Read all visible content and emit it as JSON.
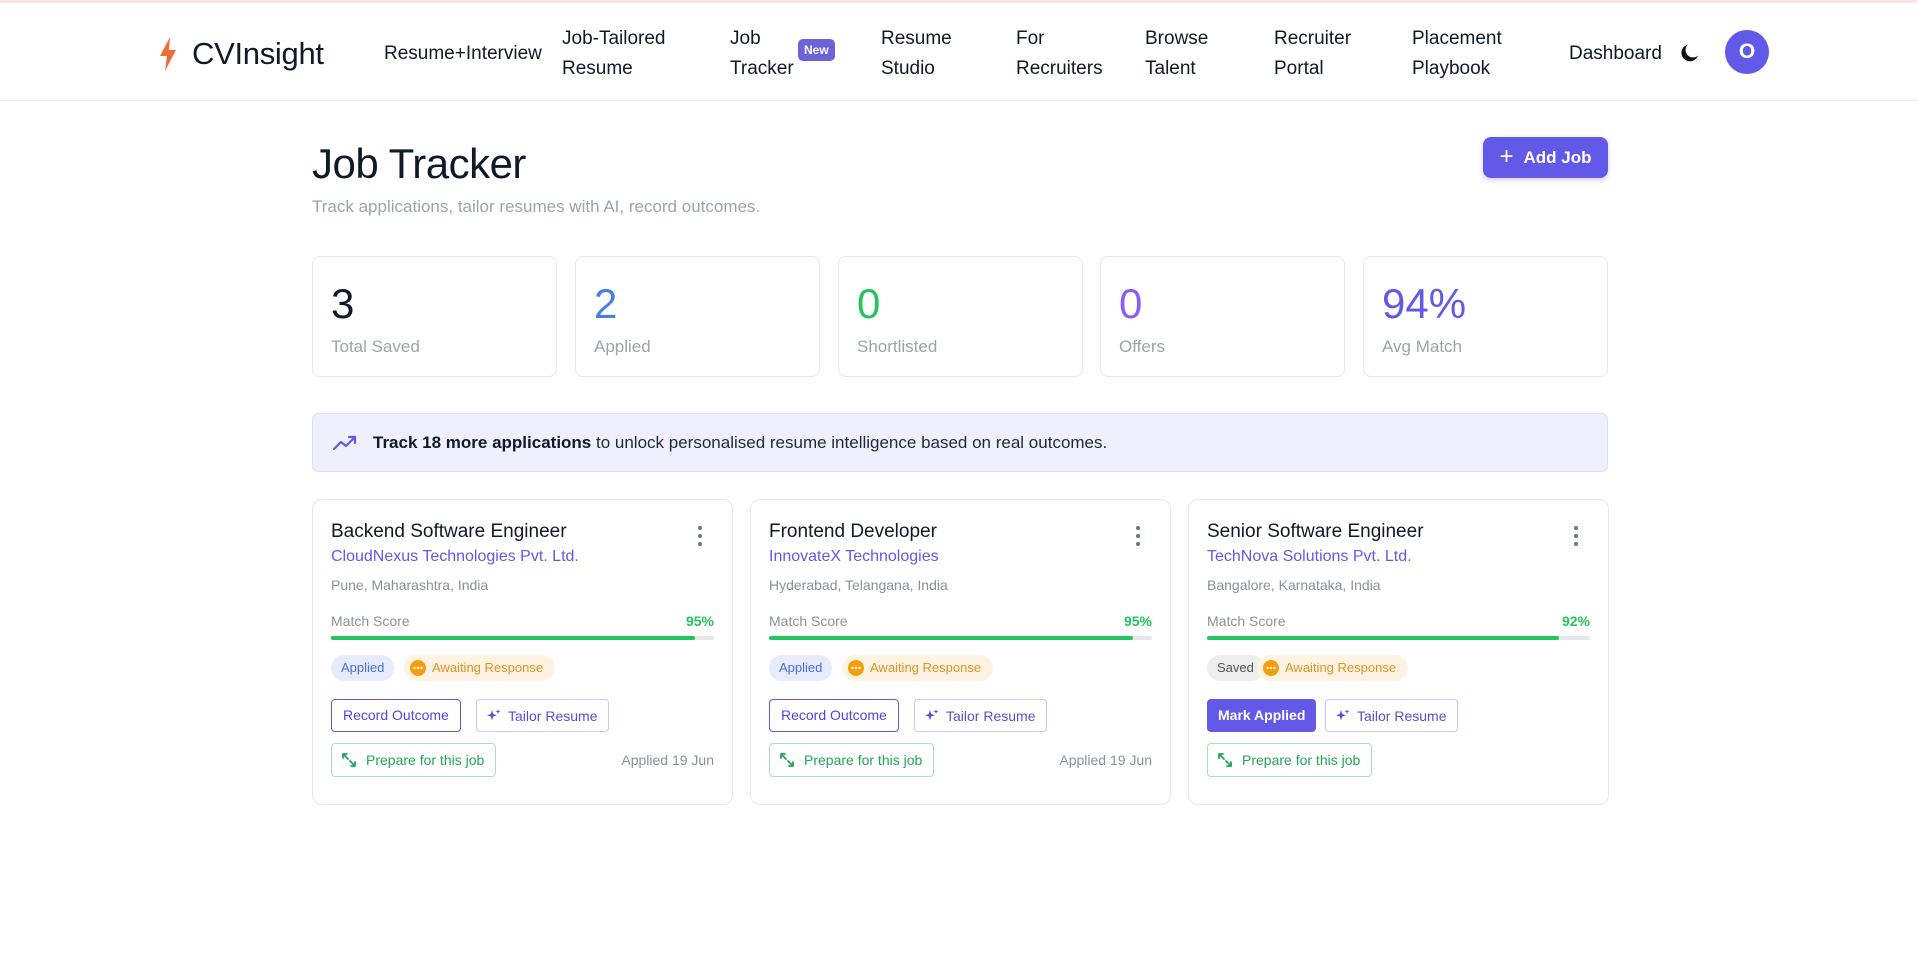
{
  "app": {
    "brand": "CVInsight",
    "accent": "#6259e8",
    "brand_icon": "lightning-bolt-icon"
  },
  "nav": {
    "items": [
      {
        "label_1": "Resume+Interview",
        "label_2": ""
      },
      {
        "label_1": "Job-Tailored",
        "label_2": "Resume"
      },
      {
        "label_1": "Job",
        "label_2": "Tracker",
        "badge": "New"
      },
      {
        "label_1": "Resume",
        "label_2": "Studio"
      },
      {
        "label_1": "For",
        "label_2": "Recruiters"
      },
      {
        "label_1": "Browse",
        "label_2": "Talent"
      },
      {
        "label_1": "Recruiter",
        "label_2": "Portal"
      },
      {
        "label_1": "Placement",
        "label_2": "Playbook"
      }
    ],
    "dashboard": "Dashboard",
    "theme_icon": "moon-icon",
    "avatar_initial": "O"
  },
  "page": {
    "title": "Job Tracker",
    "subtitle": "Track applications, tailor resumes with AI, record outcomes.",
    "add_job_label": "Add Job"
  },
  "stats": [
    {
      "value": "3",
      "label": "Total Saved",
      "color": "#111827"
    },
    {
      "value": "2",
      "label": "Applied",
      "color": "#4a7fe0"
    },
    {
      "value": "0",
      "label": "Shortlisted",
      "color": "#22c55e"
    },
    {
      "value": "0",
      "label": "Offers",
      "color": "#8b5cf6"
    },
    {
      "value": "94%",
      "label": "Avg Match",
      "color": "#6259e8"
    }
  ],
  "banner": {
    "bold": "Track 18 more applications",
    "rest": " to unlock personalised resume intelligence based on real outcomes."
  },
  "jobs": [
    {
      "title": "Backend Software Engineer",
      "company": "CloudNexus Technologies Pvt. Ltd.",
      "location": "Pune, Maharashtra, India",
      "match_label": "Match Score",
      "match_text": "95%",
      "match": 0.95,
      "status": "Applied",
      "await": "Awaiting Response",
      "action": "Record Outcome",
      "tailor": "Tailor Resume",
      "prepare": "Prepare for this job",
      "date": "Applied 19 Jun"
    },
    {
      "title": "Frontend Developer",
      "company": "InnovateX Technologies",
      "location": "Hyderabad, Telangana, India",
      "match_label": "Match Score",
      "match_text": "95%",
      "match": 0.95,
      "status": "Applied",
      "await": "Awaiting Response",
      "action": "Record Outcome",
      "tailor": "Tailor Resume",
      "prepare": "Prepare for this job",
      "date": "Applied 19 Jun"
    },
    {
      "title": "Senior Software Engineer",
      "company": "TechNova Solutions Pvt. Ltd.",
      "location": "Bangalore, Karnataka, India",
      "match_label": "Match Score",
      "match_text": "92%",
      "match": 0.92,
      "status": "Saved",
      "await": "Awaiting Response",
      "action": "Mark Applied",
      "tailor": "Tailor Resume",
      "prepare": "Prepare for this job",
      "date": ""
    }
  ]
}
